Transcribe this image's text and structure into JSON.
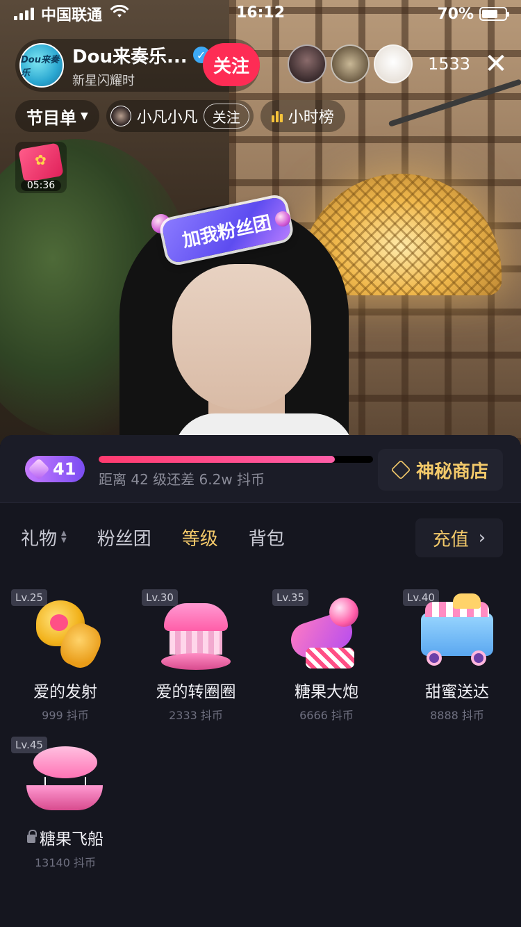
{
  "status_bar": {
    "carrier": "中国联通",
    "time": "16:12",
    "battery_percent": "70%",
    "battery_level": 0.7
  },
  "host": {
    "avatar_text": "Dou来奏乐",
    "name": "Dou来奏乐...",
    "subtitle": "新星闪耀时",
    "follow_label": "关注"
  },
  "viewers": {
    "count": "1533"
  },
  "row2": {
    "program_label": "节目单",
    "anchor_name": "小凡小凡",
    "anchor_follow_label": "关注",
    "rank_label": "小时榜"
  },
  "gift_timer": {
    "time": "05:36"
  },
  "fan_badge": {
    "label": "加我粉丝团"
  },
  "level": {
    "current": "41",
    "progress": 0.86,
    "progress_text": "距离 42 级还差 6.2w 抖币",
    "shop_label": "神秘商店"
  },
  "tabs": [
    {
      "label": "礼物"
    },
    {
      "label": "粉丝团"
    },
    {
      "label": "等级"
    },
    {
      "label": "背包"
    }
  ],
  "recharge_label": "充值",
  "gifts": [
    {
      "level": "Lv.25",
      "name": "爱的发射",
      "price": "999 抖币"
    },
    {
      "level": "Lv.30",
      "name": "爱的转圈圈",
      "price": "2333 抖币"
    },
    {
      "level": "Lv.35",
      "name": "糖果大炮",
      "price": "6666 抖币"
    },
    {
      "level": "Lv.40",
      "name": "甜蜜送达",
      "price": "8888 抖币"
    },
    {
      "level": "Lv.45",
      "name": "糖果飞船",
      "price": "13140 抖币"
    }
  ],
  "colors": {
    "follow": "#fe2c55",
    "accent_gold": "#f3c96a",
    "panel_bg": "#15161f",
    "progress": "#ff3b6f"
  }
}
